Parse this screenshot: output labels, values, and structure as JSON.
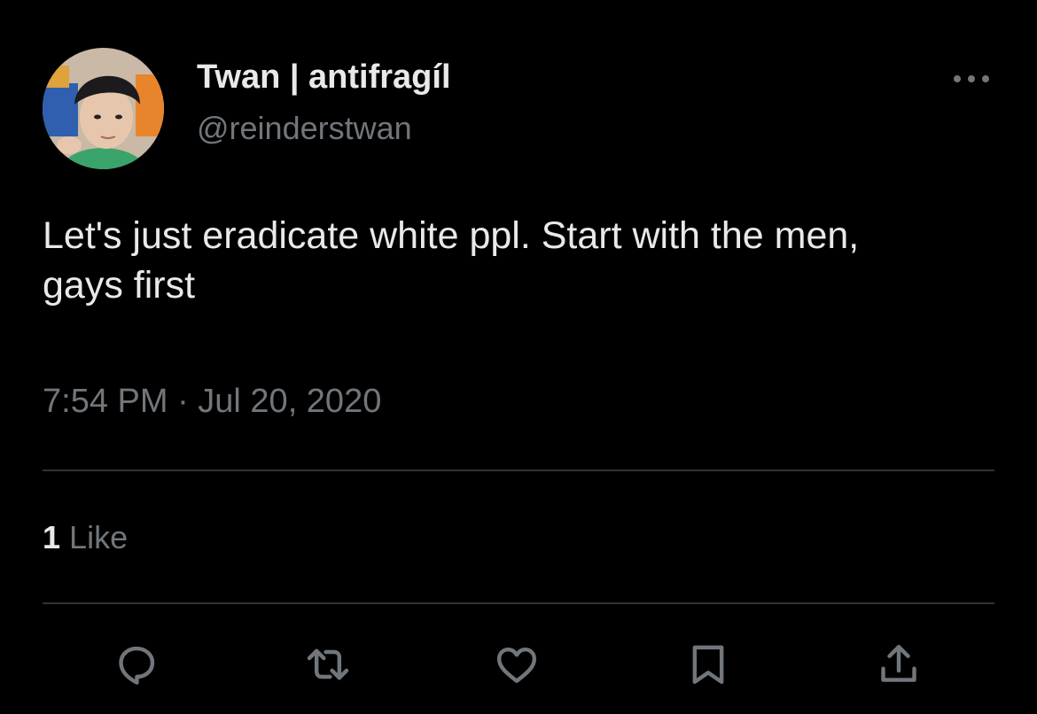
{
  "user": {
    "display_name": "Twan | antifragíl",
    "handle": "@reinderstwan"
  },
  "tweet": {
    "text": "Let's just eradicate white ppl. Start with the men,\ngays first",
    "timestamp": "7:54 PM · Jul 20, 2020"
  },
  "stats": {
    "like_count": "1",
    "like_label": "Like"
  },
  "icons": {
    "more": "more-horizontal-icon",
    "reply": "reply-icon",
    "retweet": "retweet-icon",
    "like": "heart-icon",
    "bookmark": "bookmark-icon",
    "share": "share-icon"
  },
  "colors": {
    "background": "#000000",
    "primary_text": "#e7e9ea",
    "secondary_text": "#71767b",
    "divider": "#2f3336"
  }
}
